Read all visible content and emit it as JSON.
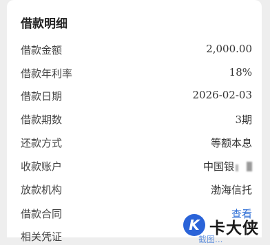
{
  "card": {
    "title": "借款明细",
    "rows": [
      {
        "label": "借款金额",
        "value": "2,000.00"
      },
      {
        "label": "借款年利率",
        "value": "18%"
      },
      {
        "label": "借款日期",
        "value": "2026-02-03"
      },
      {
        "label": "借款期数",
        "value": "3期"
      },
      {
        "label": "还款方式",
        "value": "等额本息"
      },
      {
        "label": "收款账户",
        "value": "中国银"
      },
      {
        "label": "放款机构",
        "value": "渤海信托"
      },
      {
        "label": "借款合同",
        "value": "查看"
      }
    ],
    "clipped_row_label": "相关凭证"
  },
  "watermark": {
    "badge_letter": "K",
    "brand_text": "卡大侠",
    "underlay_text": "截图..."
  },
  "colors": {
    "link": "#2f6fd6",
    "background": "#eeeeee",
    "card": "#ffffff",
    "brand_blue": "#2a63d8"
  }
}
